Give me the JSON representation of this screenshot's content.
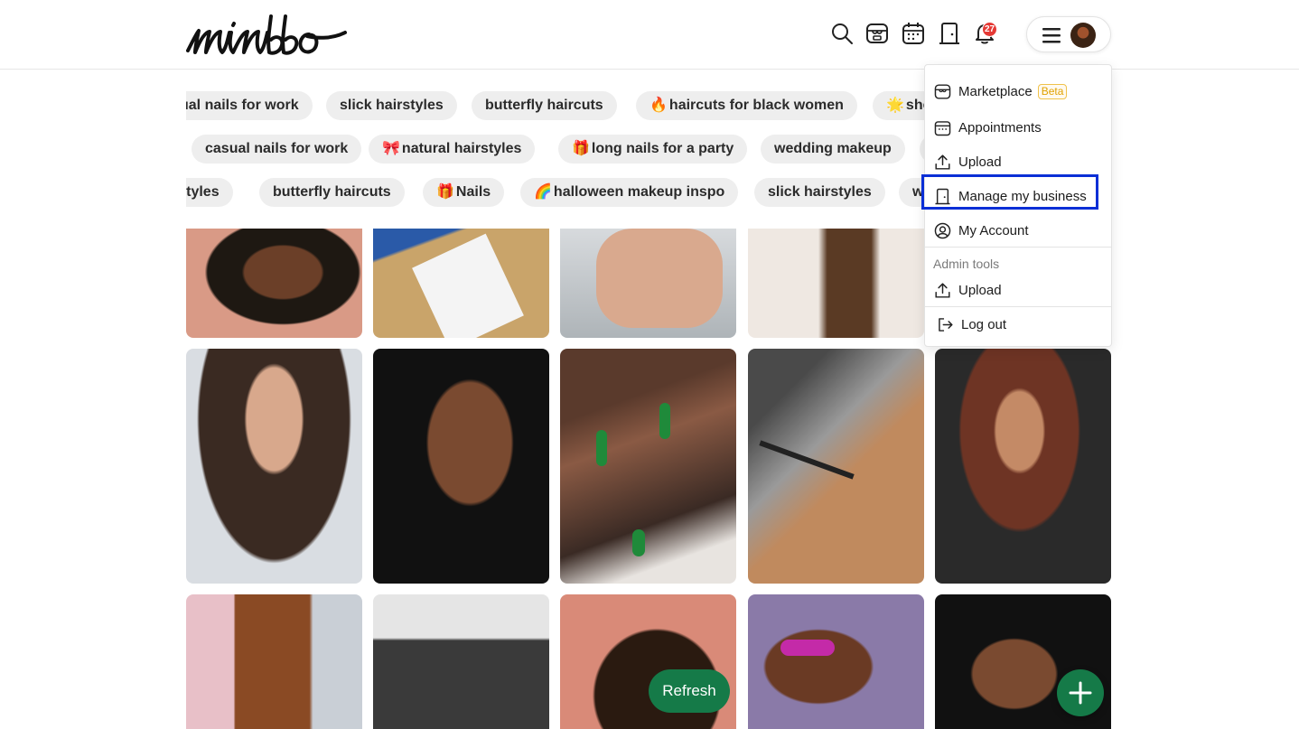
{
  "header": {
    "logo_text": "mimbbo",
    "icons": [
      "search-icon",
      "marketplace-icon",
      "calendar-icon",
      "door-icon",
      "bell-icon",
      "menu-icon"
    ],
    "notification_count": "27"
  },
  "chips": {
    "row1": [
      "ual nails for work",
      "slick hairstyles",
      "butterfly haircuts",
      "haircuts for black women",
      "she"
    ],
    "row1_emoji": [
      "",
      "",
      "",
      "🔥",
      "🌟"
    ],
    "row2": [
      "casual nails for work",
      "natural hairstyles",
      "long nails for a party",
      "wedding makeup",
      ""
    ],
    "row2_emoji": [
      "",
      "🎀",
      "🎁",
      "",
      ""
    ],
    "row3": [
      "rstyles",
      "butterfly haircuts",
      "Nails",
      "halloween makeup inspo",
      "slick hairstyles",
      "w"
    ],
    "row3_emoji": [
      "",
      "",
      "🎁",
      "🌈",
      "",
      ""
    ]
  },
  "menu": {
    "items": [
      {
        "label": "Marketplace",
        "icon": "marketplace-icon",
        "badge": "Beta"
      },
      {
        "label": "Appointments",
        "icon": "calendar-icon"
      },
      {
        "label": "Upload",
        "icon": "upload-icon"
      },
      {
        "label": "Manage my business",
        "icon": "door-icon"
      },
      {
        "label": "My Account",
        "icon": "account-icon"
      }
    ],
    "admin_label": "Admin tools",
    "admin_items": [
      {
        "label": "Upload",
        "icon": "upload-icon"
      }
    ],
    "logout_label": "Log out"
  },
  "buttons": {
    "refresh_label": "Refresh",
    "fab": "plus-icon"
  },
  "colors": {
    "accent_green": "#157a48",
    "highlight_blue": "#0b2fd6",
    "badge_red": "#e53935",
    "beta_orange": "#e0a100"
  }
}
